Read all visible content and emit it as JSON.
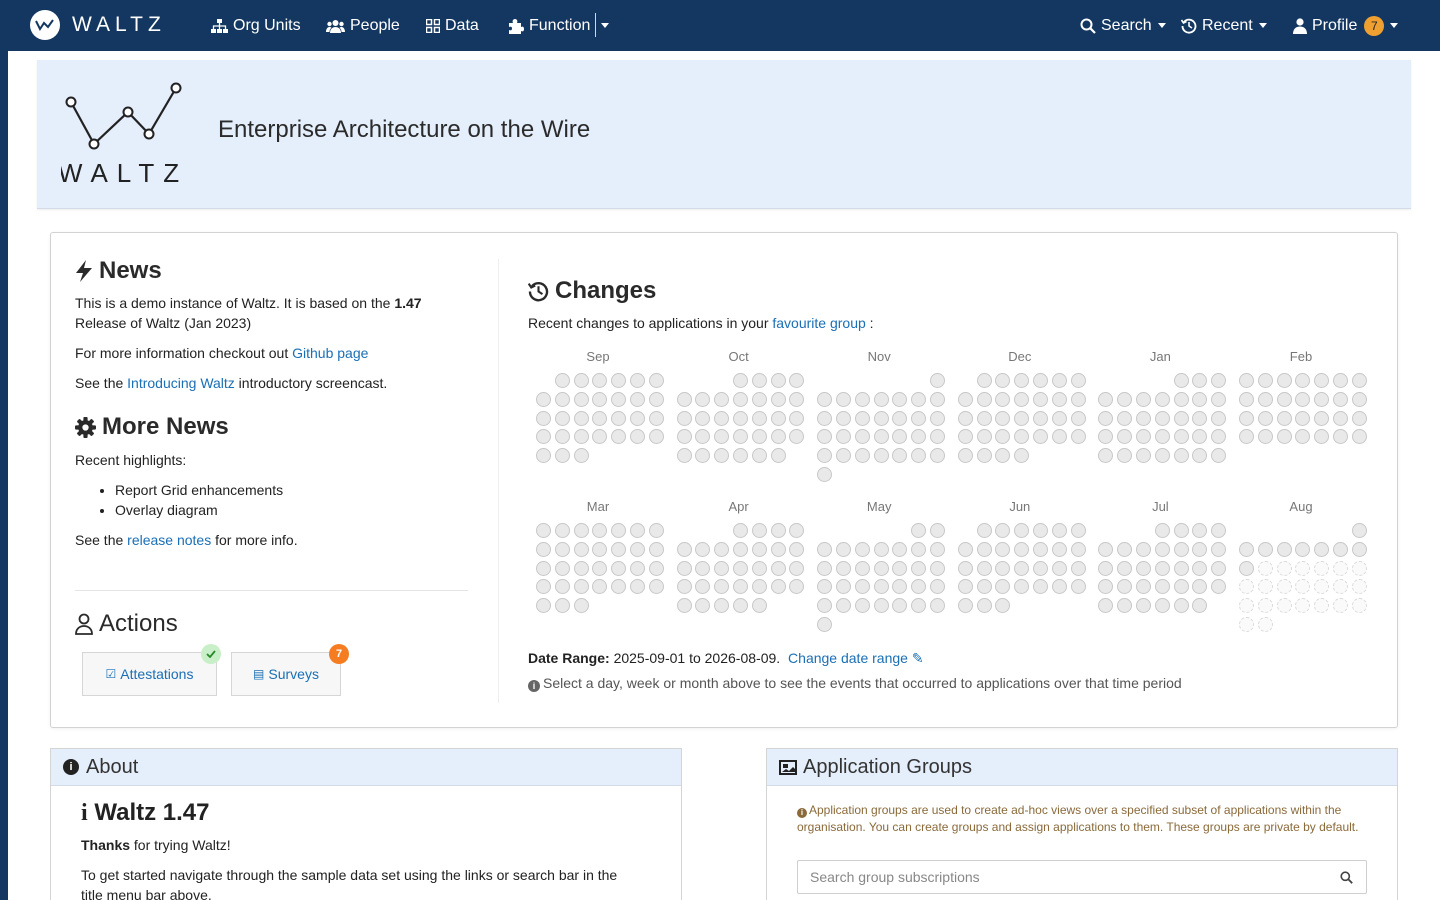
{
  "nav": {
    "brand": "WALTZ",
    "items": [
      {
        "label": "Org Units"
      },
      {
        "label": "People"
      },
      {
        "label": "Data"
      },
      {
        "label": "Function"
      }
    ],
    "search": "Search",
    "recent": "Recent",
    "profile": "Profile",
    "profile_badge": "7"
  },
  "jumbotron": {
    "logo_text": "WALTZ",
    "title": "Enterprise Architecture on the Wire"
  },
  "news": {
    "heading": "News",
    "p1_before": "This is a demo instance of Waltz. It is based on the ",
    "p1_version": "1.47",
    "p1_after": "Release of Waltz (Jan 2023)",
    "p2_before": "For more information checkout out ",
    "p2_link": "Github page",
    "p3_before": "See the ",
    "p3_link": "Introducing Waltz",
    "p3_after": " introductory screencast."
  },
  "more_news": {
    "heading": "More News",
    "intro": "Recent highlights:",
    "items": [
      "Report Grid enhancements",
      "Overlay diagram"
    ],
    "footer_before": "See the ",
    "footer_link": "release notes",
    "footer_after": " for more info."
  },
  "actions": {
    "heading": "Actions",
    "attestations": "Attestations",
    "surveys": "Surveys",
    "surveys_badge": "7"
  },
  "changes": {
    "heading": "Changes",
    "intro_before": "Recent changes to applications in your ",
    "intro_link": "favourite group",
    "intro_after": " :",
    "months_row1": [
      "Sep",
      "Oct",
      "Nov",
      "Dec",
      "Jan",
      "Feb"
    ],
    "months_row2": [
      "Mar",
      "Apr",
      "May",
      "Jun",
      "Jul",
      "Aug"
    ],
    "date_range_label": "Date Range:",
    "date_range_value": "2025-09-01 to 2026-08-09.",
    "change_link": "Change date range",
    "hint": "Select a day, week or month above to see the events that occurred to applications over that time period"
  },
  "about": {
    "header": "About",
    "title": "Waltz 1.47",
    "thanks_bold": "Thanks",
    "thanks_rest": " for trying Waltz!",
    "body": "To get started navigate through the sample data set using the links or search bar in the title menu bar above."
  },
  "app_groups": {
    "header": "Application Groups",
    "info": "Application groups are used to create ad-hoc views over a specified subset of applications within the organisation. You can create groups and assign applications to them. These groups are private by default.",
    "search_placeholder": "Search group subscriptions"
  },
  "colors": {
    "navbar": "#143761",
    "panel_header": "#e5eefb",
    "link": "#1a6fb5",
    "badge_orange": "#f0a030",
    "badge_green": "#c8efc8"
  }
}
